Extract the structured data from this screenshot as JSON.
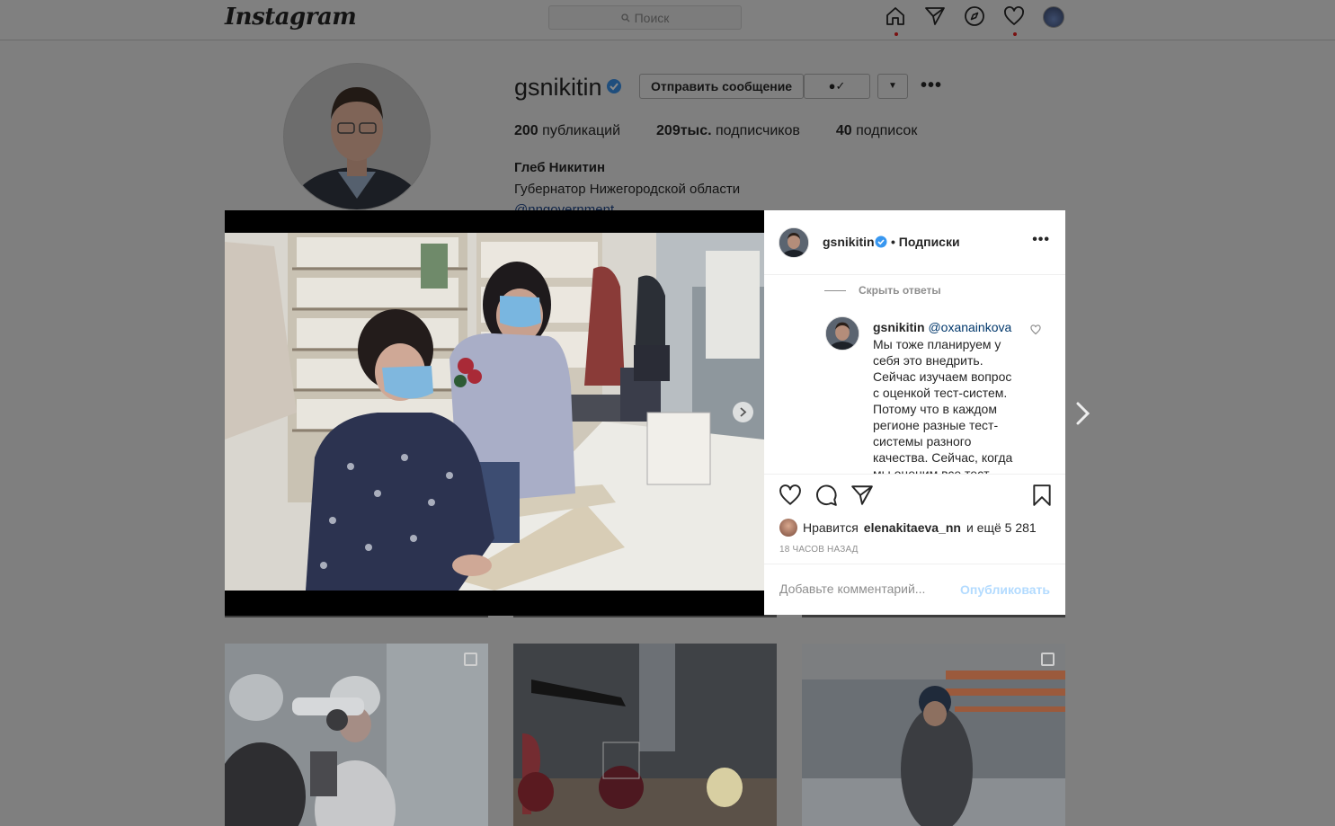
{
  "topbar": {
    "logo": "Instagram",
    "search_placeholder": "Поиск",
    "nav_icons": [
      "home-icon",
      "direct-icon",
      "explore-icon",
      "activity-heart-icon",
      "profile-avatar"
    ]
  },
  "profile": {
    "username": "gsnikitin",
    "message_button": "Отправить сообщение",
    "follow_icon": "✓",
    "stats": {
      "posts_value": "200",
      "posts_label": "публикаций",
      "followers_value": "209тыс.",
      "followers_label": "подписчиков",
      "following_value": "40",
      "following_label": "подписок"
    },
    "full_name": "Глеб Никитин",
    "bio": "Губернатор Нижегородской области",
    "bio_link": "@nngovernment"
  },
  "post": {
    "username": "gsnikitin",
    "follow_status": "• Подписки",
    "hide_replies": "Скрыть ответы",
    "reply": {
      "username": "gsnikitin",
      "mention": "@oxanainkova",
      "text": "Мы тоже планируем у себя это внедрить. Сейчас изучаем вопрос с оценкой тест-систем. Потому что в каждом регионе разные тест-системы разного качества. Сейчас, когда мы оценим все тест-"
    },
    "likes_prefix": "Нравится",
    "likes_user": "elenakitaeva_nn",
    "likes_suffix": "и ещё 5 281",
    "timestamp": "18 часов назад",
    "comment_placeholder": "Добавьте комментарий...",
    "publish_label": "Опубликовать",
    "carousel_count": 4,
    "carousel_active": 0
  },
  "colors": {
    "accent": "#0095f6",
    "publish_disabled": "#b3dbff",
    "verified": "#3897f0",
    "overlay_bg": "#7f7f7f"
  }
}
